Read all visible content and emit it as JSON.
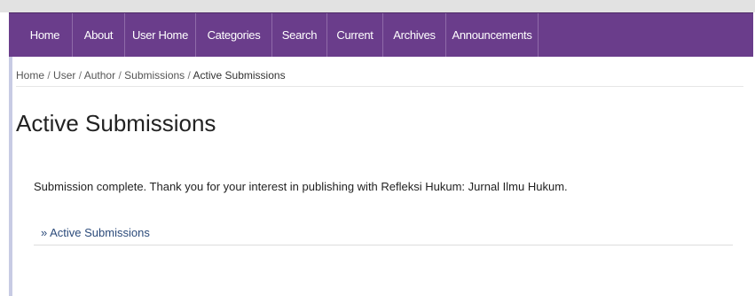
{
  "nav": {
    "items": [
      {
        "label": "Home"
      },
      {
        "label": "About"
      },
      {
        "label": "User Home"
      },
      {
        "label": "Categories"
      },
      {
        "label": "Search"
      },
      {
        "label": "Current"
      },
      {
        "label": "Archives"
      },
      {
        "label": "Announcements"
      }
    ]
  },
  "breadcrumb": {
    "items": [
      "Home",
      "User",
      "Author",
      "Submissions",
      "Active Submissions"
    ],
    "separator": "/"
  },
  "page": {
    "title": "Active Submissions",
    "message": "Submission complete. Thank you for your interest in publishing with Refleksi Hukum: Jurnal Ilmu Hukum.",
    "link_label": "» Active Submissions"
  },
  "colors": {
    "nav_background": "#6a3d8b",
    "link": "#2b4a7a"
  }
}
